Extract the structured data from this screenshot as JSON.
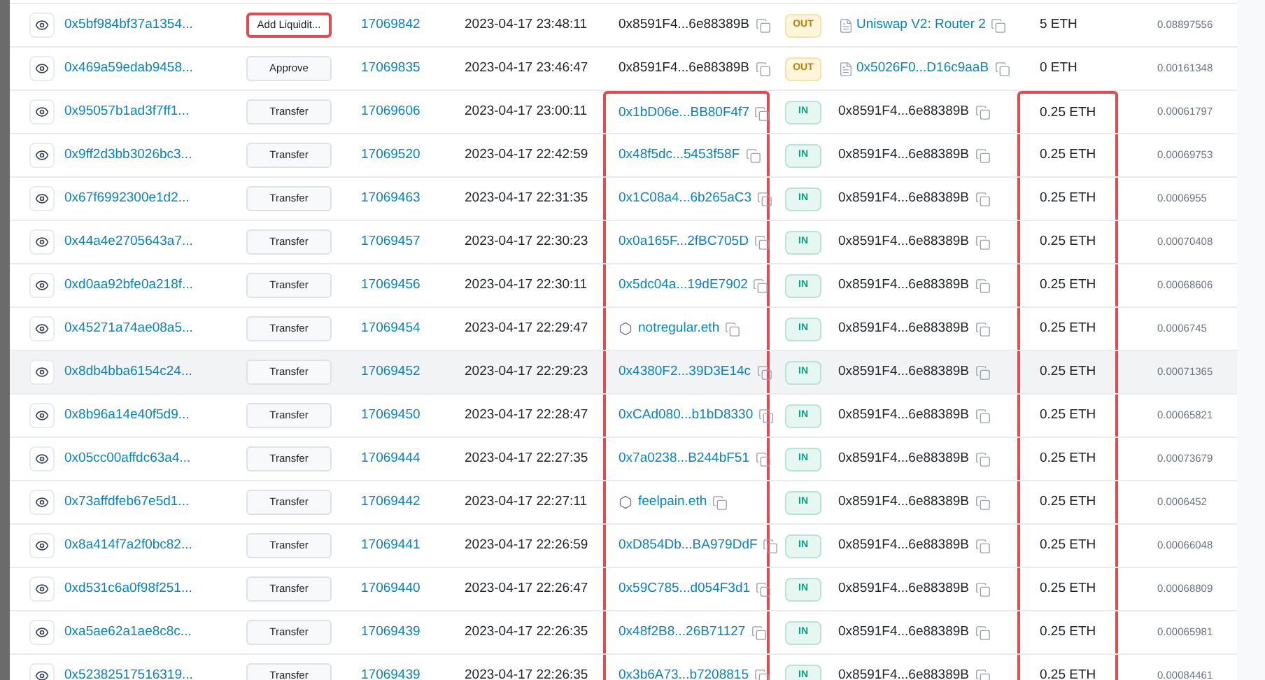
{
  "rows": [
    {
      "hash": "0x5bf984bf37a1354...",
      "method": "Add Liquidit...",
      "method_highlighted": true,
      "block": "17069842",
      "age": "2023-04-17 23:48:11",
      "from": {
        "kind": "address",
        "text": "0x8591F4...6e88389B"
      },
      "from_highlighted": false,
      "direction": "OUT",
      "to": {
        "kind": "contract",
        "text": "Uniswap V2: Router 2"
      },
      "value": "5 ETH",
      "value_highlighted": false,
      "fee": "0.08897556",
      "hovered": false
    },
    {
      "hash": "0x469a59edab9458...",
      "method": "Approve",
      "method_highlighted": false,
      "block": "17069835",
      "age": "2023-04-17 23:46:47",
      "from": {
        "kind": "address",
        "text": "0x8591F4...6e88389B"
      },
      "from_highlighted": false,
      "direction": "OUT",
      "to": {
        "kind": "contract",
        "text": "0x5026F0...D16c9aaB"
      },
      "value": "0 ETH",
      "value_highlighted": false,
      "fee": "0.00161348",
      "hovered": false
    },
    {
      "hash": "0x95057b1ad3f7ff1...",
      "method": "Transfer",
      "method_highlighted": false,
      "block": "17069606",
      "age": "2023-04-17 23:00:11",
      "from": {
        "kind": "link",
        "text": "0x1bD06e...BB80F4f7"
      },
      "from_highlighted": true,
      "direction": "IN",
      "to": {
        "kind": "address",
        "text": "0x8591F4...6e88389B"
      },
      "value": "0.25 ETH",
      "value_highlighted": true,
      "fee": "0.00061797",
      "hovered": false
    },
    {
      "hash": "0x9ff2d3bb3026bc3...",
      "method": "Transfer",
      "method_highlighted": false,
      "block": "17069520",
      "age": "2023-04-17 22:42:59",
      "from": {
        "kind": "link",
        "text": "0x48f5dc...5453f58F"
      },
      "from_highlighted": true,
      "direction": "IN",
      "to": {
        "kind": "address",
        "text": "0x8591F4...6e88389B"
      },
      "value": "0.25 ETH",
      "value_highlighted": true,
      "fee": "0.00069753",
      "hovered": false
    },
    {
      "hash": "0x67f6992300e1d2...",
      "method": "Transfer",
      "method_highlighted": false,
      "block": "17069463",
      "age": "2023-04-17 22:31:35",
      "from": {
        "kind": "link",
        "text": "0x1C08a4...6b265aC3"
      },
      "from_highlighted": true,
      "direction": "IN",
      "to": {
        "kind": "address",
        "text": "0x8591F4...6e88389B"
      },
      "value": "0.25 ETH",
      "value_highlighted": true,
      "fee": "0.0006955",
      "hovered": false
    },
    {
      "hash": "0x44a4e2705643a7...",
      "method": "Transfer",
      "method_highlighted": false,
      "block": "17069457",
      "age": "2023-04-17 22:30:23",
      "from": {
        "kind": "link",
        "text": "0x0a165F...2fBC705D"
      },
      "from_highlighted": true,
      "direction": "IN",
      "to": {
        "kind": "address",
        "text": "0x8591F4...6e88389B"
      },
      "value": "0.25 ETH",
      "value_highlighted": true,
      "fee": "0.00070408",
      "hovered": false
    },
    {
      "hash": "0xd0aa92bfe0a218f...",
      "method": "Transfer",
      "method_highlighted": false,
      "block": "17069456",
      "age": "2023-04-17 22:30:11",
      "from": {
        "kind": "link",
        "text": "0x5dc04a...19dE7902"
      },
      "from_highlighted": true,
      "direction": "IN",
      "to": {
        "kind": "address",
        "text": "0x8591F4...6e88389B"
      },
      "value": "0.25 ETH",
      "value_highlighted": true,
      "fee": "0.00068606",
      "hovered": false
    },
    {
      "hash": "0x45271a74ae08a5...",
      "method": "Transfer",
      "method_highlighted": false,
      "block": "17069454",
      "age": "2023-04-17 22:29:47",
      "from": {
        "kind": "ens",
        "text": "notregular.eth"
      },
      "from_highlighted": true,
      "direction": "IN",
      "to": {
        "kind": "address",
        "text": "0x8591F4...6e88389B"
      },
      "value": "0.25 ETH",
      "value_highlighted": true,
      "fee": "0.0006745",
      "hovered": false
    },
    {
      "hash": "0x8db4bba6154c24...",
      "method": "Transfer",
      "method_highlighted": false,
      "block": "17069452",
      "age": "2023-04-17 22:29:23",
      "from": {
        "kind": "link",
        "text": "0x4380F2...39D3E14c"
      },
      "from_highlighted": true,
      "direction": "IN",
      "to": {
        "kind": "address",
        "text": "0x8591F4...6e88389B"
      },
      "value": "0.25 ETH",
      "value_highlighted": true,
      "fee": "0.00071365",
      "hovered": true
    },
    {
      "hash": "0x8b96a14e40f5d9...",
      "method": "Transfer",
      "method_highlighted": false,
      "block": "17069450",
      "age": "2023-04-17 22:28:47",
      "from": {
        "kind": "link",
        "text": "0xCAd080...b1bD8330"
      },
      "from_highlighted": true,
      "direction": "IN",
      "to": {
        "kind": "address",
        "text": "0x8591F4...6e88389B"
      },
      "value": "0.25 ETH",
      "value_highlighted": true,
      "fee": "0.00065821",
      "hovered": false
    },
    {
      "hash": "0x05cc00affdc63a4...",
      "method": "Transfer",
      "method_highlighted": false,
      "block": "17069444",
      "age": "2023-04-17 22:27:35",
      "from": {
        "kind": "link",
        "text": "0x7a0238...B244bF51"
      },
      "from_highlighted": true,
      "direction": "IN",
      "to": {
        "kind": "address",
        "text": "0x8591F4...6e88389B"
      },
      "value": "0.25 ETH",
      "value_highlighted": true,
      "fee": "0.00073679",
      "hovered": false
    },
    {
      "hash": "0x73affdfeb67e5d1...",
      "method": "Transfer",
      "method_highlighted": false,
      "block": "17069442",
      "age": "2023-04-17 22:27:11",
      "from": {
        "kind": "ens",
        "text": "feelpain.eth"
      },
      "from_highlighted": true,
      "direction": "IN",
      "to": {
        "kind": "address",
        "text": "0x8591F4...6e88389B"
      },
      "value": "0.25 ETH",
      "value_highlighted": true,
      "fee": "0.0006452",
      "hovered": false
    },
    {
      "hash": "0x8a414f7a2f0bc82...",
      "method": "Transfer",
      "method_highlighted": false,
      "block": "17069441",
      "age": "2023-04-17 22:26:59",
      "from": {
        "kind": "link",
        "text": "0xD854Db...BA979DdF"
      },
      "from_highlighted": true,
      "direction": "IN",
      "to": {
        "kind": "address",
        "text": "0x8591F4...6e88389B"
      },
      "value": "0.25 ETH",
      "value_highlighted": true,
      "fee": "0.00066048",
      "hovered": false
    },
    {
      "hash": "0xd531c6a0f98f251...",
      "method": "Transfer",
      "method_highlighted": false,
      "block": "17069440",
      "age": "2023-04-17 22:26:47",
      "from": {
        "kind": "link",
        "text": "0x59C785...d054F3d1"
      },
      "from_highlighted": true,
      "direction": "IN",
      "to": {
        "kind": "address",
        "text": "0x8591F4...6e88389B"
      },
      "value": "0.25 ETH",
      "value_highlighted": true,
      "fee": "0.00068809",
      "hovered": false
    },
    {
      "hash": "0xa5ae62a1ae8c8c...",
      "method": "Transfer",
      "method_highlighted": false,
      "block": "17069439",
      "age": "2023-04-17 22:26:35",
      "from": {
        "kind": "link",
        "text": "0x48f2B8...26B71127"
      },
      "from_highlighted": true,
      "direction": "IN",
      "to": {
        "kind": "address",
        "text": "0x8591F4...6e88389B"
      },
      "value": "0.25 ETH",
      "value_highlighted": true,
      "fee": "0.00065981",
      "hovered": false
    },
    {
      "hash": "0x52382517516319...",
      "method": "Transfer",
      "method_highlighted": false,
      "block": "17069439",
      "age": "2023-04-17 22:26:35",
      "from": {
        "kind": "link",
        "text": "0x3b6A73...b7208815"
      },
      "from_highlighted": true,
      "direction": "IN",
      "to": {
        "kind": "address",
        "text": "0x8591F4...6e88389B"
      },
      "value": "0.25 ETH",
      "value_highlighted": true,
      "fee": "0.00084461",
      "hovered": false
    }
  ]
}
